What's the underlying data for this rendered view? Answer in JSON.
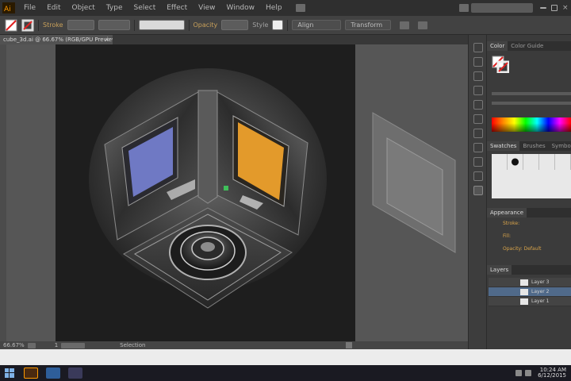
{
  "menubar": {
    "items": [
      "File",
      "Edit",
      "Object",
      "Type",
      "Select",
      "Effect",
      "View",
      "Window",
      "Help"
    ]
  },
  "controlbar": {
    "stroke_label": "Stroke",
    "opacity_label": "Opacity",
    "style_label": "Style",
    "align_label": "Align",
    "transform_label": "Transform"
  },
  "document": {
    "tab_title": "cube_3d.ai @ 66.67% (RGB/GPU Preview)",
    "close_glyph": "×"
  },
  "artwork": {
    "faces": {
      "left_panel_color": "#6f79c4",
      "right_panel_color": "#e39a2b",
      "metal_color": "#4a4a4a",
      "highlight_color": "#d8d8d8"
    }
  },
  "panels": {
    "color_tabs": [
      "Color",
      "Color Guide"
    ],
    "swatch_tabs": [
      "Swatches",
      "Brushes",
      "Symbols"
    ],
    "appearance_tab": "Appearance",
    "appearance_items": [
      "Stroke:",
      "Fill:",
      "Opacity: Default"
    ],
    "layers_tab": "Layers",
    "layers": [
      {
        "name": "Layer 3",
        "selected": false
      },
      {
        "name": "Layer 2",
        "selected": true
      },
      {
        "name": "Layer 1",
        "selected": false
      }
    ]
  },
  "statusbar": {
    "zoom": "66.67%",
    "artboard_number": "1",
    "tool_name": "Selection"
  },
  "taskbar": {
    "time": "10:24 AM",
    "date": "6/12/2015"
  }
}
